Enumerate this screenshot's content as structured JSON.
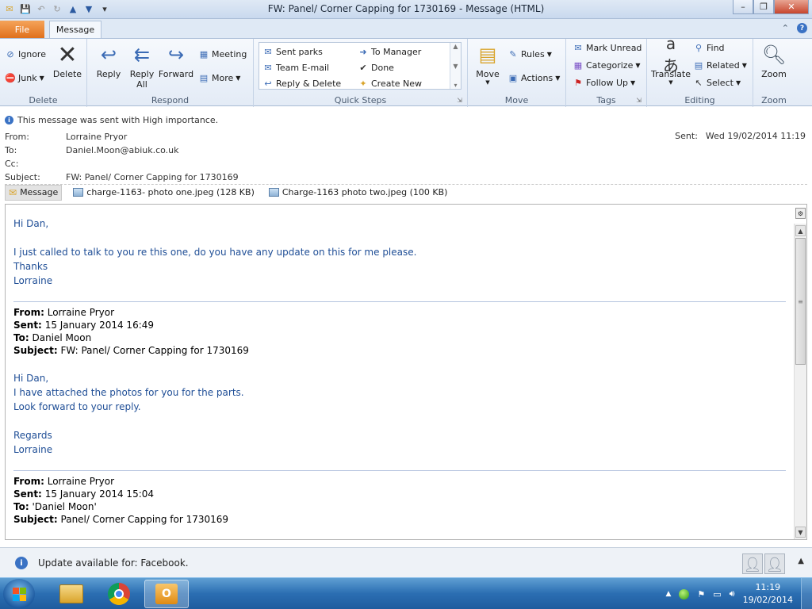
{
  "window": {
    "title": "FW: Panel/ Corner Capping for 1730169  -  Message (HTML)",
    "minimize": "–",
    "restore": "❐",
    "close": "✕"
  },
  "tabs": {
    "file": "File",
    "message": "Message"
  },
  "ribbon": {
    "delete_group": {
      "label": "Delete",
      "ignore": "Ignore",
      "junk": "Junk",
      "delete": "Delete"
    },
    "respond_group": {
      "label": "Respond",
      "reply": "Reply",
      "reply_all_1": "Reply",
      "reply_all_2": "All",
      "forward": "Forward",
      "meeting": "Meeting",
      "more": "More"
    },
    "quick_steps": {
      "label": "Quick Steps",
      "items": [
        "Sent parks",
        "Team E-mail",
        "Reply & Delete",
        "To Manager",
        "Done",
        "Create New"
      ]
    },
    "move_group": {
      "label": "Move",
      "move": "Move",
      "rules": "Rules",
      "actions": "Actions"
    },
    "tags_group": {
      "label": "Tags",
      "mark_unread": "Mark Unread",
      "categorize": "Categorize",
      "follow_up": "Follow Up"
    },
    "editing_group": {
      "label": "Editing",
      "translate": "Translate",
      "find": "Find",
      "related": "Related",
      "select": "Select"
    },
    "zoom_group": {
      "label": "Zoom",
      "zoom": "Zoom"
    }
  },
  "header": {
    "importance": "This message was sent with High importance.",
    "from_label": "From:",
    "from": "Lorraine Pryor",
    "to_label": "To:",
    "to": "Daniel.Moon@abiuk.co.uk",
    "cc_label": "Cc:",
    "cc": "",
    "subject_label": "Subject:",
    "subject": "FW: Panel/ Corner Capping for 1730169",
    "sent_label": "Sent:",
    "sent": "Wed 19/02/2014 11:19"
  },
  "attachments": [
    {
      "name": "Message",
      "selected": true
    },
    {
      "name": "charge-1163- photo one.jpeg (128 KB)"
    },
    {
      "name": "Charge-1163 photo two.jpeg (100 KB)"
    }
  ],
  "body": {
    "greeting": "Hi Dan,",
    "line1": "I just called to talk to you re this one, do you have any update on this for me please.",
    "thanks": "Thanks",
    "sign": "Lorraine",
    "fw1": {
      "from_label": "From:",
      "from": "Lorraine Pryor",
      "sent_label": "Sent:",
      "sent": "15 January 2014 16:49",
      "to_label": "To:",
      "to": "Daniel Moon",
      "subject_label": "Subject:",
      "subject": "FW: Panel/ Corner Capping for 1730169",
      "greeting": "Hi Dan,",
      "line1": "I have attached the photos for you for the parts.",
      "line2": "Look forward to your reply.",
      "regards": "Regards",
      "sign": "Lorraine"
    },
    "fw2": {
      "from_label": "From:",
      "from": "Lorraine Pryor",
      "sent_label": "Sent:",
      "sent": "15 January 2014 15:04",
      "to_label": "To:",
      "to": "'Daniel Moon'",
      "subject_label": "Subject:",
      "subject": "Panel/ Corner Capping for 1730169"
    }
  },
  "people_pane": {
    "text": "Update available for: Facebook."
  },
  "taskbar": {
    "time": "11:19",
    "date": "19/02/2014"
  },
  "colors": {
    "body_text": "#1f4e96",
    "file_tab": "#e0701c",
    "taskbar": "#2b6eb2"
  }
}
